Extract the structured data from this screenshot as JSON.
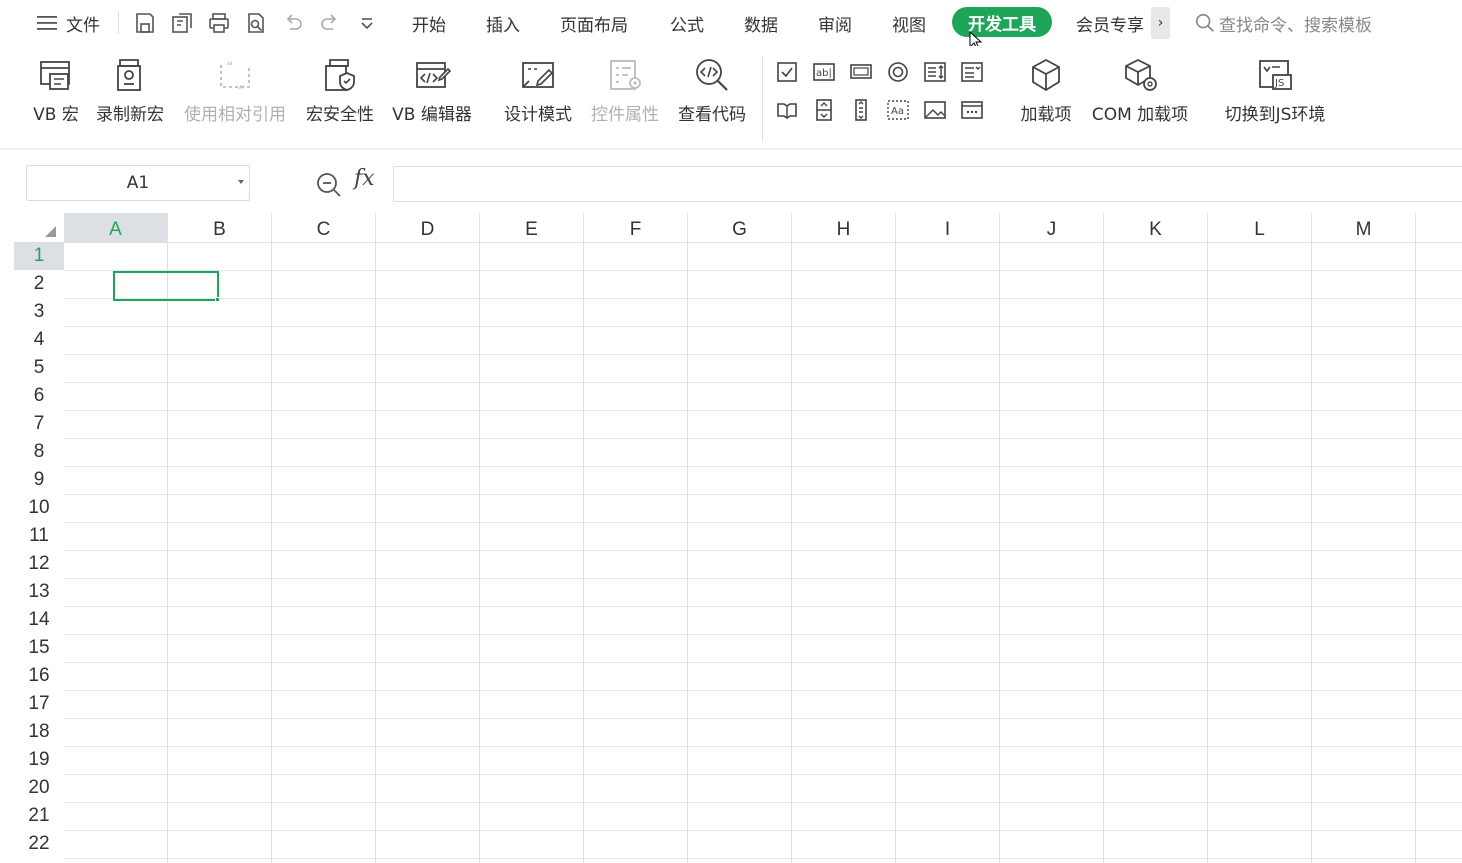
{
  "menubar": {
    "file_label": "文件",
    "tabs": [
      "开始",
      "插入",
      "页面布局",
      "公式",
      "数据",
      "审阅",
      "视图"
    ],
    "active_tab": "开发工具",
    "member_tab": "会员专享",
    "more_glyph": "›",
    "search_placeholder": "查找命令、搜索模板",
    "accent_color": "#1fa55a"
  },
  "ribbon": {
    "buttons": {
      "vb_macro": "VB 宏",
      "record_macro": "录制新宏",
      "relative_ref": "使用相对引用",
      "macro_security": "宏安全性",
      "vb_editor": "VB 编辑器",
      "design_mode": "设计模式",
      "control_props": "控件属性",
      "view_code": "查看代码",
      "addins": "加载项",
      "com_addins": "COM 加载项",
      "switch_js": "切换到JS环境"
    },
    "controls_row1": [
      "checkbox-icon",
      "textbox-icon",
      "command-button-icon",
      "option-button-icon",
      "listbox-icon",
      "combobox-icon"
    ],
    "controls_row2": [
      "toggle-button-icon",
      "spin-button-icon",
      "scrollbar-icon",
      "label-icon",
      "image-icon",
      "more-controls-icon"
    ]
  },
  "formula": {
    "name_box": "A1",
    "fx_label": "fx",
    "formula_value": ""
  },
  "grid": {
    "columns": [
      "A",
      "B",
      "C",
      "D",
      "E",
      "F",
      "G",
      "H",
      "I",
      "J",
      "K",
      "L",
      "M"
    ],
    "rows": [
      "1",
      "2",
      "3",
      "4",
      "5",
      "6",
      "7",
      "8",
      "9",
      "10",
      "11",
      "12",
      "13",
      "14",
      "15",
      "16",
      "17",
      "18",
      "19",
      "20",
      "21",
      "22"
    ],
    "selected_column": "A",
    "selected_row": "1"
  }
}
